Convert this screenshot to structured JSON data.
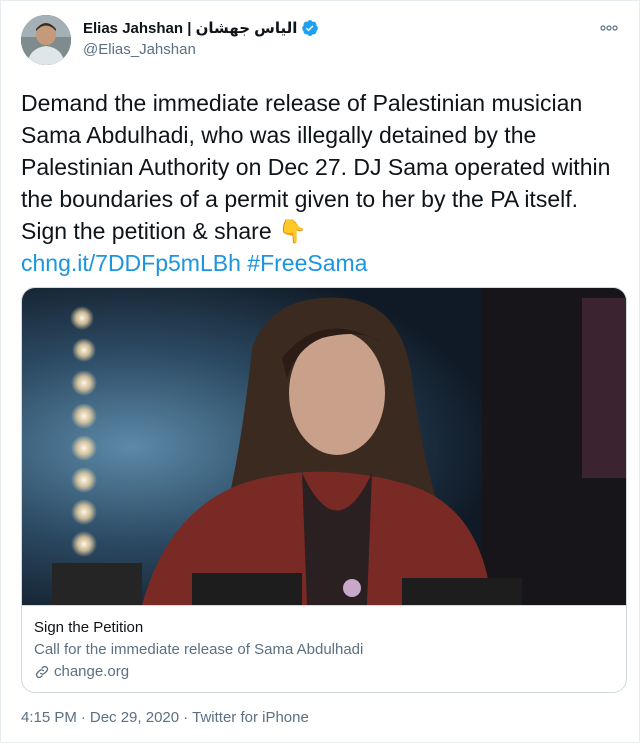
{
  "author": {
    "display_name": "Elias Jahshan | الياس جهشان",
    "handle": "@Elias_Jahshan",
    "verified": true
  },
  "tweet": {
    "text": "Demand the immediate release of Palestinian musician Sama Abdulhadi, who was illegally detained by the Palestinian Authority on Dec 27. DJ Sama operated within the boundaries of a permit given to her by the PA itself. Sign the petition & share",
    "emoji": "👇",
    "link": "chng.it/7DDFp5mLBh",
    "hashtag": "#FreeSama"
  },
  "card": {
    "title": "Sign the Petition",
    "description": "Call for the immediate release of Sama Abdulhadi",
    "domain": "change.org"
  },
  "footer": {
    "time": "4:15 PM",
    "separator": "·",
    "date": "Dec 29, 2020",
    "source": "Twitter for iPhone"
  },
  "colors": {
    "link": "#1b95e0",
    "secondary_text": "#5b7083",
    "verified_badge": "#1da1f2"
  }
}
